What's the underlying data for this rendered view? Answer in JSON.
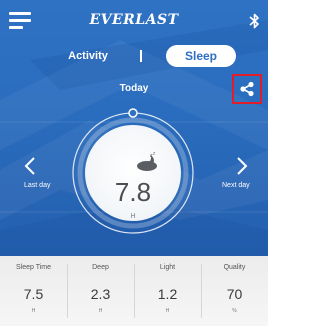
{
  "header": {
    "brand": "EVERLAST",
    "menu_icon": "hamburger-menu-icon",
    "bluetooth_icon": "bluetooth-icon"
  },
  "tabs": {
    "activity_label": "Activity",
    "sleep_label": "Sleep",
    "selected": "Sleep"
  },
  "date_label": "Today",
  "share_icon": "share-icon",
  "dial": {
    "icon": "sleeping-moon-icon",
    "value": "7.8",
    "unit": "H"
  },
  "navigation": {
    "prev_label": "Last day",
    "next_label": "Next day"
  },
  "stats": [
    {
      "label": "Sleep Time",
      "value": "7.5",
      "unit": "H"
    },
    {
      "label": "Deep",
      "value": "2.3",
      "unit": "H"
    },
    {
      "label": "Light",
      "value": "1.2",
      "unit": "H"
    },
    {
      "label": "Quality",
      "value": "70",
      "unit": "%"
    }
  ],
  "colors": {
    "header_blue": "#2f72c4",
    "highlight_red": "#e11d2a",
    "tab_text_blue": "#2f6fc2"
  }
}
